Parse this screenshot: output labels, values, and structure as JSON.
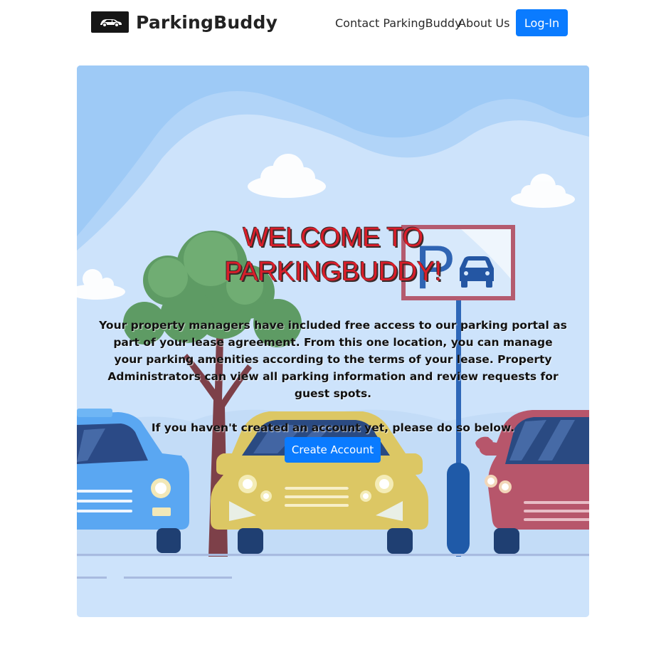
{
  "brand": {
    "name": "ParkingBuddy",
    "logo_icon": "car-logo-icon"
  },
  "nav": {
    "contact": "Contact ParkingBuddy",
    "about": "About Us",
    "login": "Log-In"
  },
  "hero": {
    "title_line1": "WELCOME TO",
    "title_line2": "PARKINGBUDDY!",
    "paragraph": "Your property managers have included free access to our parking portal as part of your lease agreement. From this one location, you can manage your parking amenities according to the terms of your lease. Property Administrators can view all parking information and review requests for guest spots.",
    "prompt": "If you haven't created an account yet, please do so below.",
    "cta": "Create Account",
    "sign_letter": "P"
  },
  "colors": {
    "primary": "#0a7bff",
    "title_red": "#d81e2a",
    "sky": "#cfe4fb"
  }
}
